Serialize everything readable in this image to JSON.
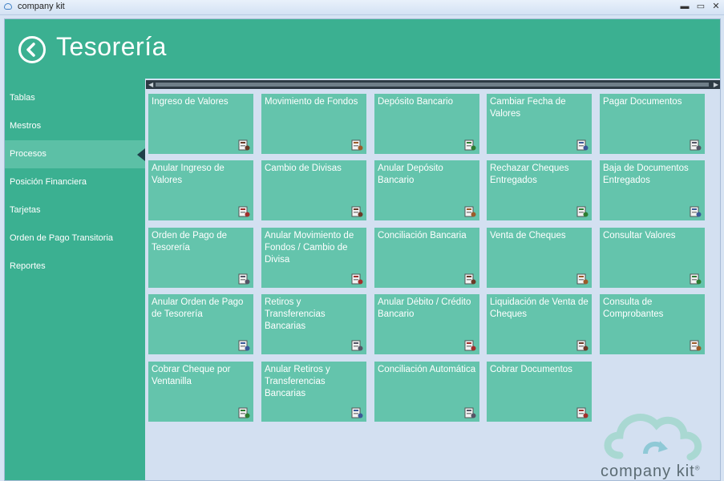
{
  "window": {
    "title": "company kit",
    "minimize": "▬",
    "maximize": "▭",
    "close": "✕"
  },
  "page": {
    "title": "Tesorería"
  },
  "sidebar": {
    "items": [
      {
        "label": "Tablas"
      },
      {
        "label": "Mestros"
      },
      {
        "label": "Procesos"
      },
      {
        "label": "Posición Financiera"
      },
      {
        "label": "Tarjetas"
      },
      {
        "label": "Orden de Pago Transitoria"
      },
      {
        "label": "Reportes"
      }
    ],
    "active": "Procesos"
  },
  "tiles": [
    {
      "label": "Ingreso de Valores",
      "icon": "money-in-icon"
    },
    {
      "label": "Movimiento de Fondos",
      "icon": "fund-transfer-icon"
    },
    {
      "label": "Depósito Bancario",
      "icon": "bank-deposit-icon"
    },
    {
      "label": "Cambiar Fecha de Valores",
      "icon": "calendar-icon"
    },
    {
      "label": "Pagar Documentos",
      "icon": "pay-documents-icon"
    },
    {
      "label": "Anular Ingreso de Valores",
      "icon": "cancel-money-in-icon"
    },
    {
      "label": "Cambio de Divisas",
      "icon": "currency-exchange-icon"
    },
    {
      "label": "Anular Depósito Bancario",
      "icon": "cancel-deposit-icon"
    },
    {
      "label": "Rechazar Cheques Entregados",
      "icon": "reject-check-icon"
    },
    {
      "label": "Baja de Documentos Entregados",
      "icon": "remove-documents-icon"
    },
    {
      "label": "Orden de Pago de Tesorería",
      "icon": "payment-order-icon"
    },
    {
      "label": "Anular Movimiento de Fondos / Cambio de Divisa",
      "icon": "cancel-fund-transfer-icon"
    },
    {
      "label": "Conciliación Bancaria",
      "icon": "bank-reconciliation-icon"
    },
    {
      "label": "Venta de Cheques",
      "icon": "check-sale-icon"
    },
    {
      "label": "Consultar Valores",
      "icon": "query-values-icon"
    },
    {
      "label": "Anular Orden de Pago de Tesorería",
      "icon": "cancel-payment-order-icon"
    },
    {
      "label": "Retiros y Transferencias Bancarias",
      "icon": "bank-withdrawal-icon"
    },
    {
      "label": "Anular Débito / Crédito Bancario",
      "icon": "cancel-debit-credit-icon"
    },
    {
      "label": "Liquidación de Venta de Cheques",
      "icon": "check-liquidation-icon"
    },
    {
      "label": "Consulta de Comprobantes",
      "icon": "query-vouchers-icon"
    },
    {
      "label": "Cobrar Cheque por Ventanilla",
      "icon": "cash-check-icon"
    },
    {
      "label": "Anular Retiros y Transferencias Bancarias",
      "icon": "cancel-withdrawal-icon"
    },
    {
      "label": "Conciliación Automática",
      "icon": "auto-reconciliation-icon"
    },
    {
      "label": "Cobrar Documentos",
      "icon": "collect-documents-icon"
    }
  ],
  "logo": {
    "text": "company kit",
    "mark": "®"
  },
  "colors": {
    "header": "#3bb091",
    "tile": "#64c4ac",
    "background": "#d3e0f1"
  }
}
